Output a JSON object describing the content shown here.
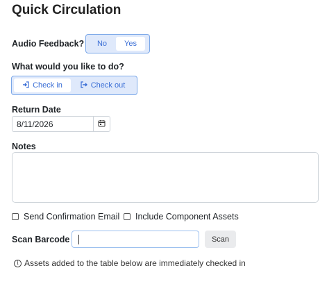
{
  "page": {
    "title": "Quick Circulation"
  },
  "audio_feedback": {
    "label": "Audio Feedback?",
    "options": [
      "No",
      "Yes"
    ],
    "selected": "Yes"
  },
  "action": {
    "label": "What would you like to do?",
    "check_in": {
      "icon": "sign-in-icon",
      "label": "Check in"
    },
    "check_out": {
      "icon": "sign-out-icon",
      "label": "Check out"
    },
    "selected": "Check in"
  },
  "return_date": {
    "label": "Return Date",
    "value": "8/11/2026",
    "icon": "calendar-icon"
  },
  "notes": {
    "label": "Notes",
    "value": ""
  },
  "options": {
    "send_email": {
      "label": "Send Confirmation Email",
      "checked": false
    },
    "include_components": {
      "label": "Include Component Assets",
      "checked": false
    }
  },
  "scan": {
    "label": "Scan Barcode",
    "value": "",
    "button_label": "Scan"
  },
  "info": {
    "icon": "info-icon",
    "glyph": "i",
    "text": "Assets added to the table below are immediately checked in"
  }
}
